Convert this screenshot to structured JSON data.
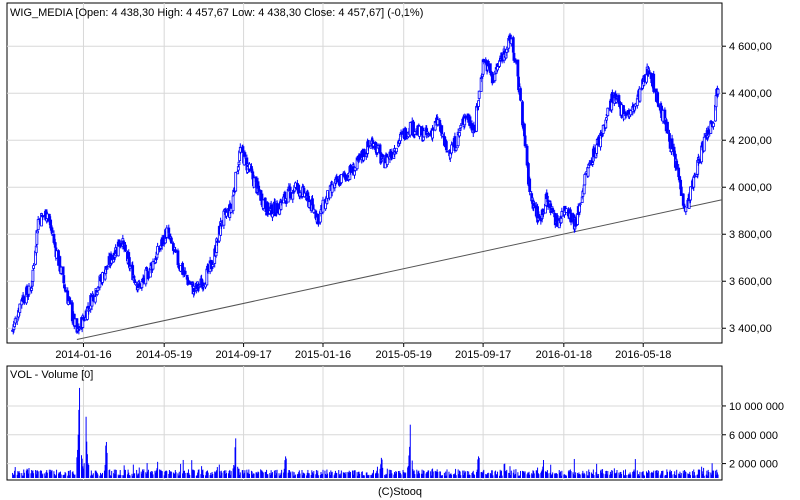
{
  "chart_data": [
    {
      "type": "candlestick",
      "title": "WIG_MEDIA [Open: 4 438,30  High: 4 457,67  Low: 4 438,30  Close: 4 457,67] (-0,1%)",
      "x_tick_labels": [
        "2014-01-16",
        "2014-05-19",
        "2014-09-17",
        "2015-01-16",
        "2015-05-19",
        "2015-09-17",
        "2016-01-18",
        "2016-05-18"
      ],
      "y_tick_labels": [
        "4 600,00",
        "4 400,00",
        "4 200,00",
        "4 000,00",
        "3 800,00",
        "3 600,00",
        "3 400,00"
      ],
      "ylim": [
        3350,
        4720
      ],
      "grid": true,
      "series_color": "#0000ff",
      "trendline": {
        "from": {
          "date": "2014-01-06",
          "value": 3352
        },
        "to": {
          "date": "2016-09-09",
          "value": 3943
        },
        "color": "#555555"
      },
      "close_series": {
        "dates": [
          "2013-09-30",
          "2013-10-14",
          "2013-10-28",
          "2013-11-08",
          "2013-11-22",
          "2013-12-06",
          "2013-12-20",
          "2014-01-06",
          "2014-01-16",
          "2014-01-30",
          "2014-02-14",
          "2014-02-28",
          "2014-03-14",
          "2014-03-28",
          "2014-04-11",
          "2014-04-25",
          "2014-05-09",
          "2014-05-23",
          "2014-06-06",
          "2014-06-20",
          "2014-07-04",
          "2014-07-18",
          "2014-08-01",
          "2014-08-15",
          "2014-08-29",
          "2014-09-12",
          "2014-09-26",
          "2014-10-10",
          "2014-10-24",
          "2014-11-07",
          "2014-11-21",
          "2014-12-05",
          "2014-12-19",
          "2015-01-09",
          "2015-01-23",
          "2015-02-06",
          "2015-02-20",
          "2015-03-06",
          "2015-03-20",
          "2015-04-03",
          "2015-04-17",
          "2015-05-01",
          "2015-05-15",
          "2015-05-29",
          "2015-06-12",
          "2015-06-26",
          "2015-07-10",
          "2015-07-24",
          "2015-08-07",
          "2015-08-21",
          "2015-09-04",
          "2015-09-18",
          "2015-10-02",
          "2015-10-16",
          "2015-10-30",
          "2015-11-13",
          "2015-11-27",
          "2015-12-11",
          "2015-12-23",
          "2016-01-08",
          "2016-01-22",
          "2016-02-05",
          "2016-02-19",
          "2016-03-04",
          "2016-03-18",
          "2016-04-01",
          "2016-04-15",
          "2016-04-29",
          "2016-05-13",
          "2016-05-27",
          "2016-06-10",
          "2016-06-24",
          "2016-07-08",
          "2016-07-22",
          "2016-08-05",
          "2016-08-19",
          "2016-09-02",
          "2016-09-09"
        ],
        "values": [
          3390,
          3530,
          3560,
          3860,
          3890,
          3720,
          3560,
          3380,
          3440,
          3540,
          3620,
          3700,
          3780,
          3660,
          3570,
          3640,
          3720,
          3810,
          3700,
          3620,
          3560,
          3600,
          3680,
          3860,
          3910,
          4160,
          4070,
          3980,
          3900,
          3910,
          3960,
          4000,
          3970,
          3870,
          3960,
          4020,
          4050,
          4080,
          4150,
          4200,
          4100,
          4150,
          4210,
          4260,
          4230,
          4220,
          4280,
          4150,
          4190,
          4310,
          4250,
          4550,
          4460,
          4560,
          4630,
          4380,
          3980,
          3860,
          3950,
          3850,
          3920,
          3840,
          4030,
          4150,
          4250,
          4380,
          4330,
          4310,
          4400,
          4510,
          4360,
          4240,
          4080,
          3900,
          4050,
          4200,
          4300,
          4440
        ]
      }
    },
    {
      "type": "bar",
      "title": "VOL - Volume [0]",
      "y_tick_labels": [
        "10 000 000",
        "6 000 000",
        "2 000 000"
      ],
      "ylim": [
        0,
        13600000
      ],
      "series_color": "#0000ff",
      "spikes": [
        {
          "date": "2014-01-10",
          "value": 12500000
        },
        {
          "date": "2014-01-20",
          "value": 8500000
        },
        {
          "date": "2014-02-20",
          "value": 5000000
        },
        {
          "date": "2014-05-10",
          "value": 3500000
        },
        {
          "date": "2014-09-05",
          "value": 5500000
        },
        {
          "date": "2014-11-20",
          "value": 3000000
        },
        {
          "date": "2015-04-15",
          "value": 2800000
        },
        {
          "date": "2015-05-29",
          "value": 7400000
        },
        {
          "date": "2015-09-10",
          "value": 3000000
        },
        {
          "date": "2015-12-18",
          "value": 2500000
        }
      ]
    }
  ],
  "footer": {
    "credit": "(C)Stooq"
  }
}
